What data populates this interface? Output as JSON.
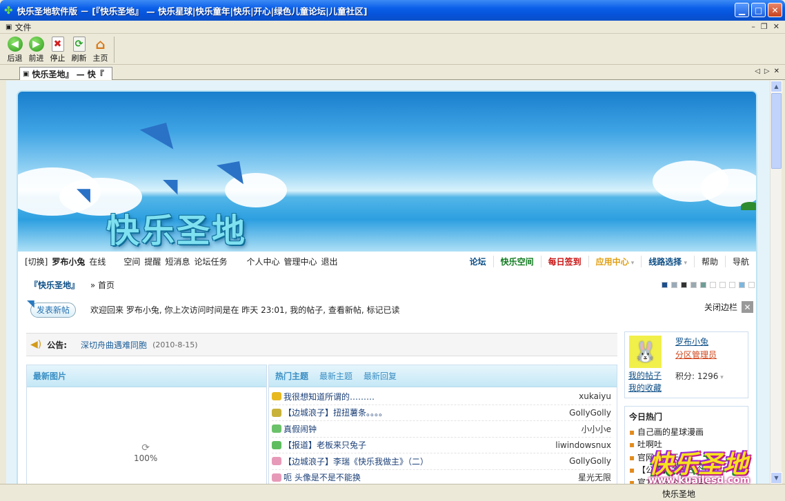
{
  "window": {
    "title": "快乐圣地软件版 － [『快乐圣地』 — 快乐星球|快乐童年|快乐|开心|绿色儿童论坛|儿童社区]"
  },
  "menubar": {
    "file": "文件"
  },
  "toolbar": {
    "back": "后退",
    "forward": "前进",
    "stop": "停止",
    "refresh": "刷新",
    "home": "主页"
  },
  "tab": {
    "label": "快乐圣地』 — 快『"
  },
  "banner": {
    "logo_text": "快乐圣地"
  },
  "nav": {
    "switch": "[切换]",
    "username": "罗布小兔",
    "online": "在线",
    "left_links": [
      "空间",
      "提醒",
      "短消息",
      "论坛任务",
      "个人中心",
      "管理中心",
      "退出"
    ],
    "right_links": [
      {
        "label": "论坛",
        "color": "#0b4d86"
      },
      {
        "label": "快乐空间",
        "color": "#0f7a1e"
      },
      {
        "label": "每日签到",
        "color": "#c81414"
      },
      {
        "label": "应用中心",
        "color": "#e0a015"
      },
      {
        "label": "线路选择",
        "color": "#0b4d86"
      },
      {
        "label": "帮助",
        "color": "#333333"
      },
      {
        "label": "导航",
        "color": "#333333"
      }
    ]
  },
  "breadcrumb": {
    "site": "『快乐圣地』",
    "sep": "»",
    "page": "首页"
  },
  "color_swatches": [
    "#1f4f8a",
    "#9aa9b7",
    "#333333",
    "#9aa8b0",
    "#6f9d96",
    "#ffffff",
    "#ffffff",
    "#ffffff",
    "#7db6dd",
    "#ffffff"
  ],
  "welcome": {
    "post_button": "发表新帖",
    "text": "欢迎回来 罗布小兔, 你上次访问时间是在 昨天 23:01, 我的帖子, 查看新帖, 标记已读",
    "close_sidebar": "关闭边栏"
  },
  "notice": {
    "label": "公告:",
    "text": "深切舟曲遇难同胞",
    "date": "(2010-8-15)"
  },
  "pictures": {
    "title": "最新图片",
    "loading": "100%"
  },
  "hot": {
    "tabs": [
      "热门主题",
      "最新主题",
      "最新回复"
    ],
    "rows": [
      {
        "title": "我很想知道所谓的………",
        "user": "xukaiyu",
        "icon_color": "#e8b81f"
      },
      {
        "title": "【边城浪子】扭扭薯条。。。。",
        "user": "GollyGolly",
        "icon_color": "#c9b23a"
      },
      {
        "title": "真假闹钟",
        "user": "小小小e",
        "icon_color": "#6cc26a"
      },
      {
        "title": "【报道】老板来只兔子",
        "user": "liwindowsnux",
        "icon_color": "#5fbd5f"
      },
      {
        "title": "【边城浪子】李瑞《快乐我做主》（二）",
        "user": "GollyGolly",
        "icon_color": "#e79ab8"
      },
      {
        "title": "呃 头像是不是不能换",
        "user": "星光无限",
        "icon_color": "#e79ab8"
      }
    ]
  },
  "user_panel": {
    "name": "罗布小兔",
    "role": "分区管理员",
    "my_posts": "我的帖子",
    "my_favs": "我的收藏",
    "score": "积分: 1296"
  },
  "today_hot": {
    "title": "今日热门",
    "items": [
      "自己画的星球漫画",
      "吐啊吐",
      "官网发展天去了",
      "【公告】关于三个月就",
      "官方论坛今天又挂彩了"
    ]
  },
  "status": {
    "text": "快乐圣地"
  },
  "watermark": {
    "logo": "快乐圣地",
    "url": "www.kuailesd.com"
  }
}
